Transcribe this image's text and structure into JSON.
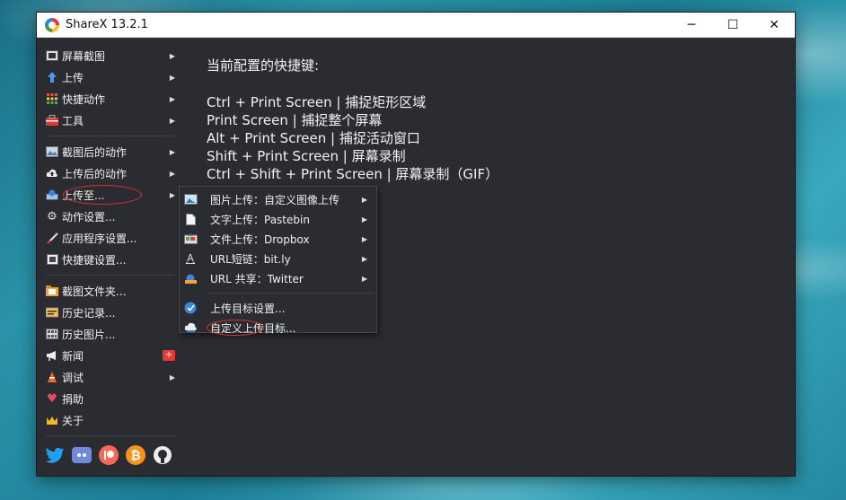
{
  "window": {
    "title": "ShareX 13.2.1",
    "controls": {
      "minimize": "─",
      "maximize": "☐",
      "close": "✕"
    }
  },
  "menu": {
    "items": [
      {
        "label": "屏幕截图",
        "icon": "screenshot-icon",
        "arrow": "▶"
      },
      {
        "label": "上传",
        "icon": "upload-arrow-icon",
        "arrow": "▶"
      },
      {
        "label": "快捷动作",
        "icon": "grid-icon",
        "arrow": "▶"
      },
      {
        "label": "工具",
        "icon": "toolbox-icon",
        "arrow": "▶"
      },
      {
        "label": "截图后的动作",
        "icon": "image-icon",
        "arrow": "▶"
      },
      {
        "label": "上传后的动作",
        "icon": "cloud-upload-icon",
        "arrow": "▶"
      },
      {
        "label": "上传至...",
        "icon": "upload-destination-icon",
        "arrow": "▶"
      },
      {
        "label": "动作设置...",
        "icon": "gear-icon"
      },
      {
        "label": "应用程序设置...",
        "icon": "wrench-icon"
      },
      {
        "label": "快捷键设置...",
        "icon": "keyboard-icon"
      },
      {
        "label": "截图文件夹...",
        "icon": "folder-icon"
      },
      {
        "label": "历史记录...",
        "icon": "history-icon"
      },
      {
        "label": "历史图片...",
        "icon": "image-history-icon"
      },
      {
        "label": "新闻",
        "icon": "megaphone-icon",
        "badge": "+"
      },
      {
        "label": "调试",
        "icon": "debug-cone-icon",
        "arrow": "▶"
      },
      {
        "label": "捐助",
        "icon": "heart-icon"
      },
      {
        "label": "关于",
        "icon": "crown-icon"
      }
    ]
  },
  "hotkeys": {
    "title": "当前配置的快捷键:",
    "lines": [
      "Ctrl + Print Screen  |  捕捉矩形区域",
      "Print Screen  |  捕捉整个屏幕",
      "Alt + Print Screen  |  捕捉活动窗口",
      "Shift + Print Screen  |  屏幕录制",
      "Ctrl + Shift + Print Screen  |  屏幕录制（GIF）"
    ]
  },
  "submenu": {
    "items": [
      {
        "label": "图片上传：自定义图像上传",
        "icon": "image-upload-icon",
        "arrow": "▶"
      },
      {
        "label": "文字上传：Pastebin",
        "icon": "text-file-icon",
        "arrow": "▶"
      },
      {
        "label": "文件上传：Dropbox",
        "icon": "file-upload-icon",
        "arrow": "▶"
      },
      {
        "label": "URL短链：bit.ly",
        "icon": "url-shortener-icon",
        "arrow": "▶"
      },
      {
        "label": "URL 共享：Twitter",
        "icon": "url-share-icon",
        "arrow": "▶"
      },
      {
        "label": "上传目标设置...",
        "icon": "globe-check-icon"
      },
      {
        "label": "自定义上传目标...",
        "icon": "cloud-icon"
      }
    ]
  },
  "social": [
    "twitter-icon",
    "discord-icon",
    "patreon-icon",
    "bitcoin-icon",
    "github-icon"
  ],
  "colors": {
    "window_bg": "#2a2c31",
    "text": "#f0f0f0",
    "highlight": "#dd3333"
  }
}
